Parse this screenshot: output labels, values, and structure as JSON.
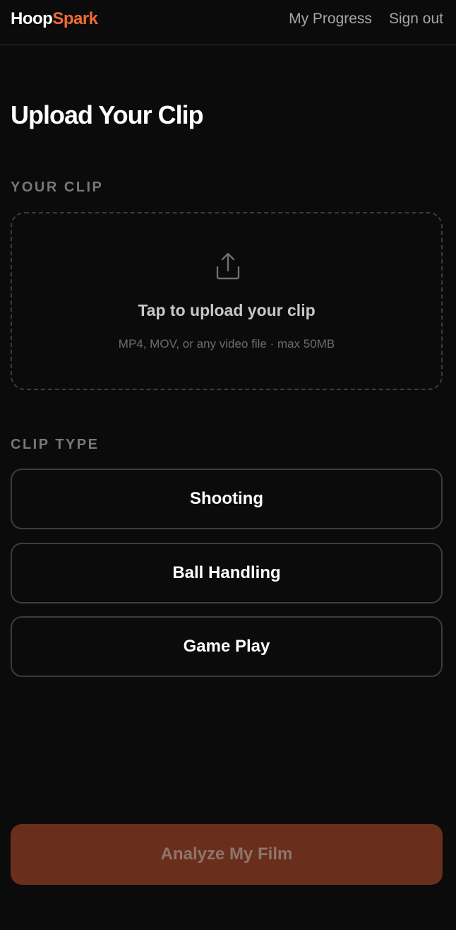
{
  "header": {
    "logo_part1": "Hoop",
    "logo_part2": "Spark",
    "nav": [
      "My Progress",
      "Sign out"
    ]
  },
  "main": {
    "title": "Upload Your Clip",
    "clip_section": {
      "label": "YOUR CLIP",
      "dropzone_title": "Tap to upload your clip",
      "dropzone_subtitle": "MP4, MOV, or any video file · max 50MB",
      "icon": "upload-icon"
    },
    "type_section": {
      "label": "CLIP TYPE",
      "options": [
        "Shooting",
        "Ball Handling",
        "Game Play"
      ]
    },
    "submit_label": "Analyze My Film",
    "submit_disabled": true
  },
  "colors": {
    "accent": "#f26a34",
    "background": "#0b0b0c",
    "submit_disabled_bg": "#6a2f1c"
  }
}
